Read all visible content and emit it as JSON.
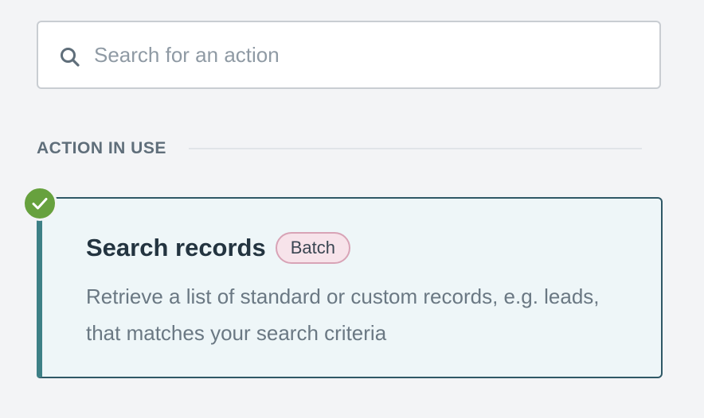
{
  "search": {
    "placeholder": "Search for an action",
    "value": "",
    "icon": "search-icon"
  },
  "section": {
    "label": "ACTION IN USE"
  },
  "action": {
    "title": "Search records",
    "badge": "Batch",
    "description": "Retrieve a list of standard or custom records, e.g. leads, that matches your search criteria",
    "selected": true,
    "status_icon": "check-icon"
  },
  "colors": {
    "background": "#f3f4f6",
    "card_background": "#eef6f8",
    "card_border": "#2f5866",
    "card_accent": "#3d8086",
    "check_green": "#67a13e",
    "badge_background": "#f7e3ea",
    "badge_border": "#d8a3b6"
  }
}
